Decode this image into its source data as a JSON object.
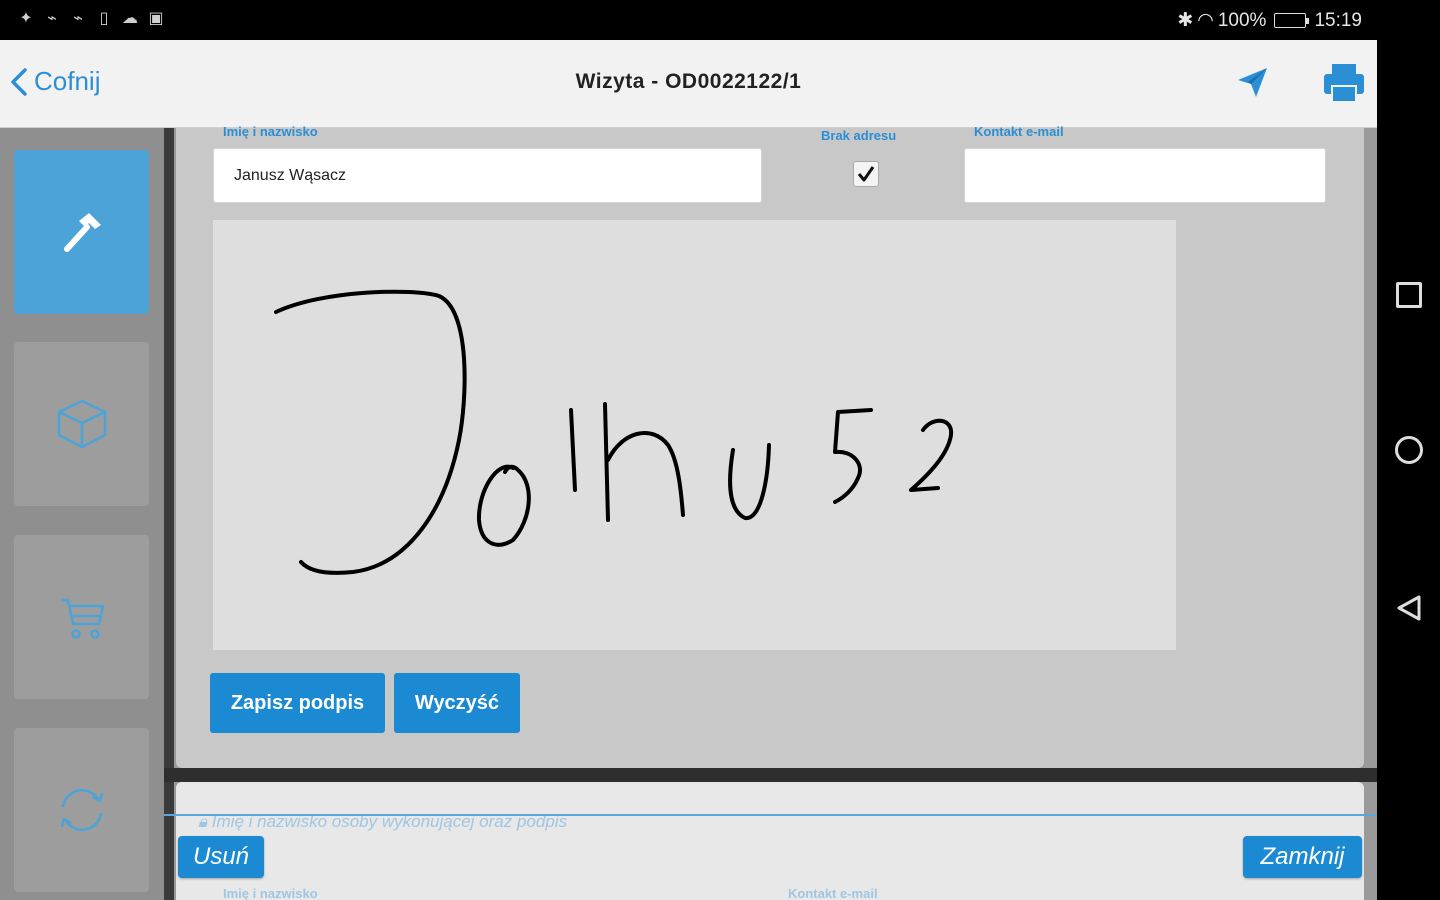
{
  "status_bar": {
    "battery": "100%",
    "time": "15:19"
  },
  "header": {
    "back_label": "Cofnij",
    "title": "Wizyta - OD0022122/1"
  },
  "form": {
    "name_label": "Imię i nazwisko",
    "name_value": "Janusz Wąsacz",
    "no_address_label": "Brak adresu",
    "no_address_checked": true,
    "email_label": "Kontakt e-mail",
    "email_value": "",
    "signature_text": "Janusz",
    "save_signature_label": "Zapisz podpis",
    "clear_label": "Wyczyść"
  },
  "second_section": {
    "header": "Imię i nazwisko osoby wykonującej oraz podpis",
    "name_label": "Imię i nazwisko",
    "email_label": "Kontakt e-mail"
  },
  "footer": {
    "delete_label": "Usuń",
    "close_label": "Zamknij"
  },
  "colors": {
    "accent": "#1b8ad3",
    "sidebar_active": "#4ba3d8",
    "link": "#2b8fd6"
  }
}
